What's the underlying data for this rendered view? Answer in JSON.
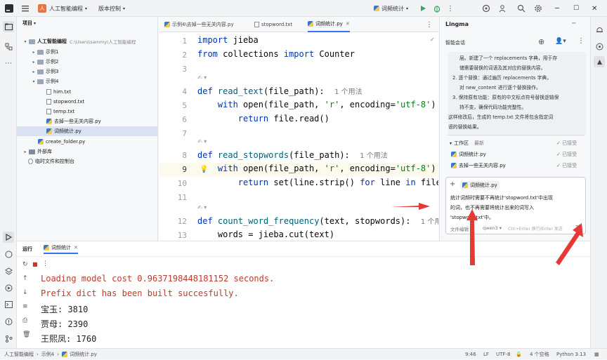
{
  "titlebar": {
    "project_badge": "人",
    "project_name": "人工智能编程",
    "vcs_label": "版本控制",
    "run_config": "词频统计"
  },
  "project_panel": {
    "title": "项目",
    "root_name": "人工智能编程",
    "root_path": "C:\\Users\\sammy\\人工智能编程",
    "items": [
      {
        "label": "示例1"
      },
      {
        "label": "示例2"
      },
      {
        "label": "示例3"
      },
      {
        "label": "示例4"
      },
      {
        "label": "him.txt"
      },
      {
        "label": "stopword.txt"
      },
      {
        "label": "temp.txt"
      },
      {
        "label": "去掉一些无关内容.py"
      },
      {
        "label": "词频统计.py"
      },
      {
        "label": "create_folder.py"
      },
      {
        "label": "外部库"
      },
      {
        "label": "临时文件和控制台"
      }
    ]
  },
  "editor": {
    "tabs": [
      {
        "label": "示例4\\去掉一些无关内容.py"
      },
      {
        "label": "stopword.txt"
      },
      {
        "label": "词频统计.py"
      }
    ],
    "line_numbers": [
      "1",
      "2",
      "3",
      "",
      "4",
      "5",
      "6",
      "7",
      "8",
      "9",
      "10",
      "11",
      "",
      "12",
      "13"
    ],
    "usage_hint": "1 个用法",
    "usage_hint_trunc": "1 个用"
  },
  "ai_panel": {
    "title": "Lingma",
    "subtitle": "智能会话",
    "message_lines": [
      "层。新建了一个 replacements 字典，用于存",
      "储需要替换的词语及其对应的替换内容。",
      "2. 逐个替换：通过遍历 replacements 字典，",
      "对 new_content 进行逐个替换操作。",
      "3. 保持原有功能：原有的中文标点符号替换逻辑保",
      "持不变，确保代码功能完整性。",
      "这样修改后，生成的 temp.txt 文件将包含指定词",
      "语的替换结果。"
    ],
    "workspace_label": "工作区",
    "workspace_sort": "最新",
    "workspace_status": "已接受",
    "files": [
      {
        "name": "词频统计.py",
        "status": "已接受"
      },
      {
        "name": "去掉一些无关内容.py",
        "status": "已接受"
      }
    ],
    "context_file": "词频统计.py",
    "prompt_lines": [
      "统计词频时需要不再统计'stopword.txt'中出现",
      "的词，也不再需要将统计出来的词写入",
      "'stopword.txt'中。"
    ],
    "mode": "文件编辑",
    "model": "qwen3",
    "send_hint": "Ctrl+Enter 换行/Enter 发送"
  },
  "run_panel": {
    "tab_run": "运行",
    "tab_config": "词频统计",
    "output": [
      {
        "text": "Loading model cost 0.9637198448181152 seconds.",
        "color": "#c0392b"
      },
      {
        "text": "Prefix dict has been built succesfully.",
        "color": "#c0392b"
      },
      {
        "text": "宝玉: 3810",
        "color": "#222222"
      },
      {
        "text": "贾母: 2390",
        "color": "#222222"
      },
      {
        "text": "王熙凤: 1760",
        "color": "#222222"
      }
    ]
  },
  "statusbar": {
    "crumbs": [
      "人工智能编程",
      "示例4",
      "词频统计.py"
    ],
    "position": "9:46",
    "line_sep": "LF",
    "encoding": "UTF-8",
    "indent": "4 个空格",
    "interpreter": "Python 3.13"
  },
  "colors": {
    "accent": "#3574f0",
    "error_text": "#c0392b",
    "annotation": "#e53935"
  }
}
